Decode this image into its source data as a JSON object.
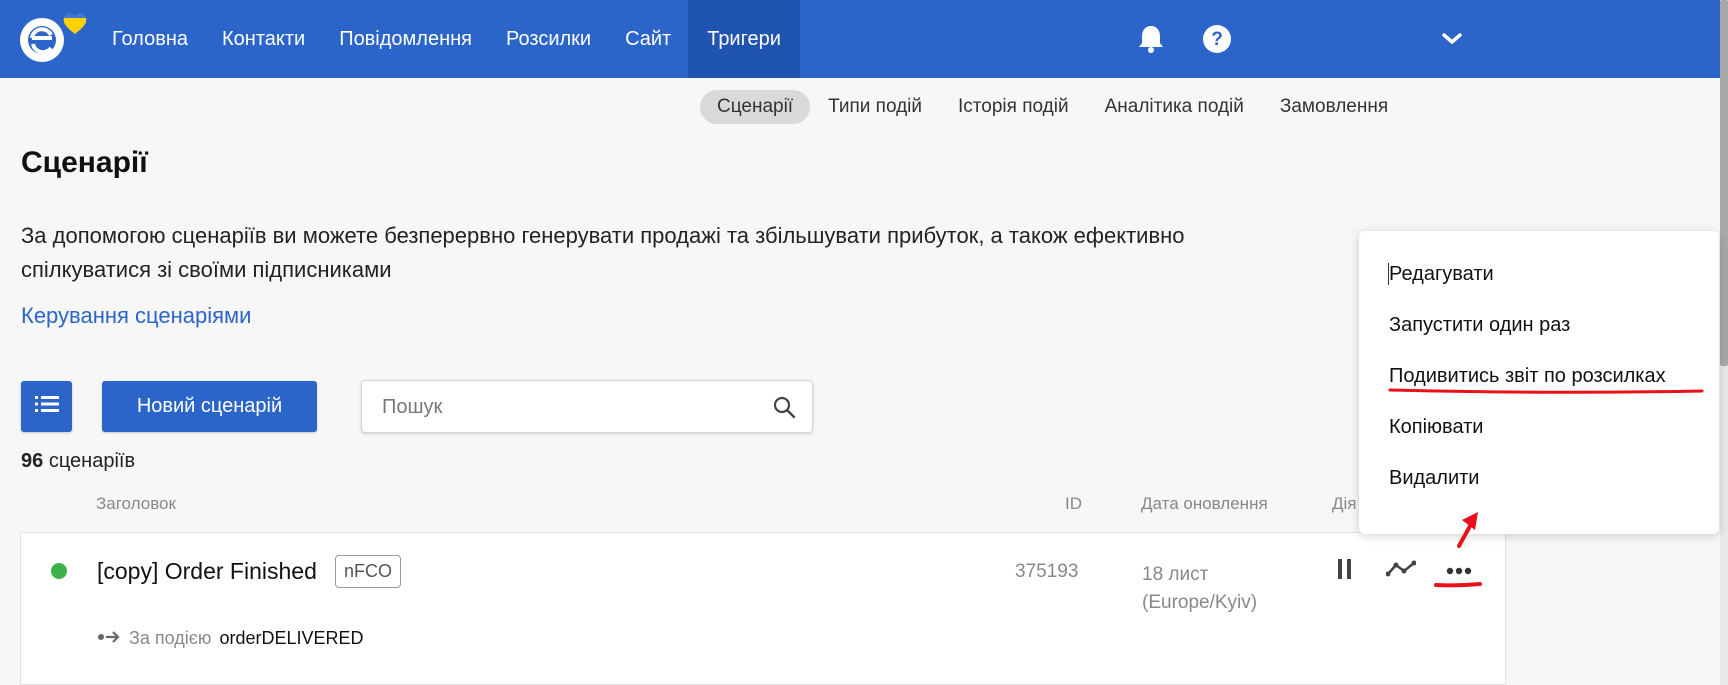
{
  "nav": {
    "items": [
      "Головна",
      "Контакти",
      "Повідомлення",
      "Розсилки",
      "Сайт",
      "Тригери"
    ],
    "active": "Тригери"
  },
  "top_icons": [
    "bell-icon",
    "help-icon",
    "chevron-down-icon"
  ],
  "subnav": {
    "items": [
      "Сценарії",
      "Типи подій",
      "Історія подій",
      "Аналітика подій",
      "Замовлення"
    ],
    "active": "Сценарії"
  },
  "page": {
    "title": "Сценарії",
    "description": "За допомогою сценаріїв ви можете безперервно генерувати продажі та збільшувати прибуток, а також ефективно спілкуватися зі своїми підписниками",
    "manage_link": "Керування сценаріями"
  },
  "toolbar": {
    "new_button": "Новий сценарій",
    "search_placeholder": "Пошук"
  },
  "count": {
    "number": "96",
    "label": "сценаріїв"
  },
  "table": {
    "headers": {
      "title": "Заголовок",
      "id": "ID",
      "updated": "Дата оновлення",
      "actions": "Дія"
    },
    "rows": [
      {
        "title": "[copy] Order Finished",
        "tag": "nFCO",
        "id": "375193",
        "date_line1": "18 лист",
        "date_line2": "(Europe/Kyiv)",
        "trigger_label": "За подією",
        "trigger_value": "orderDELIVERED",
        "status": "active"
      }
    ]
  },
  "menu": {
    "items": [
      "Редагувати",
      "Запустити один раз",
      "Подивитись звіт по розсилках",
      "Копіювати",
      "Видалити"
    ]
  },
  "colors": {
    "brand": "#2b65c9",
    "status_active": "#3cb34a",
    "annotation": "#e8101a"
  }
}
